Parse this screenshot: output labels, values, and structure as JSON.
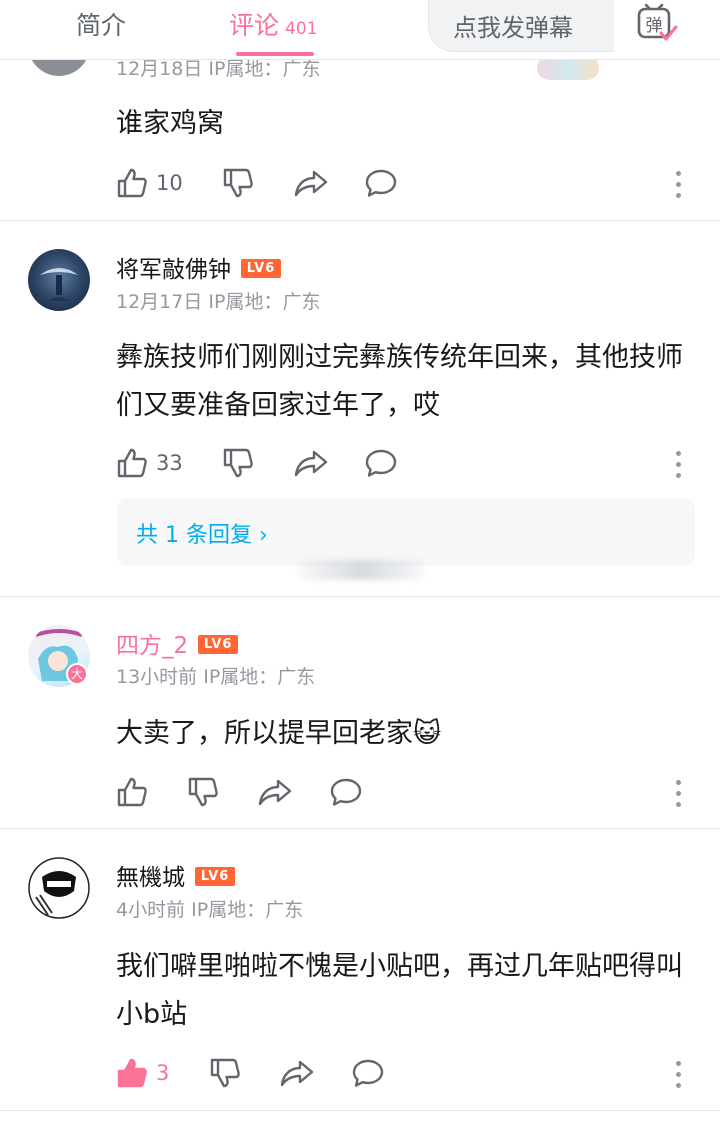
{
  "tabs": {
    "intro_label": "简介",
    "comments_label": "评论",
    "comments_count": "401"
  },
  "danmaku": {
    "placeholder": "点我发弹幕",
    "toggle_glyph": "弹"
  },
  "comments": [
    {
      "meta": "12月18日 IP属地：广东",
      "content": "谁家鸡窝",
      "likes": "10"
    },
    {
      "username": "将军敲佛钟",
      "level": "LV6",
      "meta": "12月17日 IP属地：广东",
      "content": "彝族技师们刚刚过完彝族传统年回来，其他技师们又要准备回家过年了，哎",
      "likes": "33",
      "reply_summary": "共 1 条回复 ›"
    },
    {
      "username": "四方_2",
      "level": "LV6",
      "meta": "13小时前 IP属地：广东",
      "content": "大卖了，所以提早回老家😺",
      "likes": "",
      "avatar_badge": "大"
    },
    {
      "username": "無機城",
      "level": "LV6",
      "meta": "4小时前 IP属地：广东",
      "content": "我们噼里啪啦不愧是小贴吧，再过几年贴吧得叫小b站",
      "likes": "3"
    }
  ],
  "colors": {
    "accent_pink": "#fb7299",
    "reply_link_blue": "#00aeec",
    "level_orange": "#ff6633",
    "meta_gray": "#9499a0"
  },
  "icons": [
    "like-icon",
    "dislike-icon",
    "share-icon",
    "reply-icon",
    "more-icon",
    "danmaku-icon"
  ]
}
